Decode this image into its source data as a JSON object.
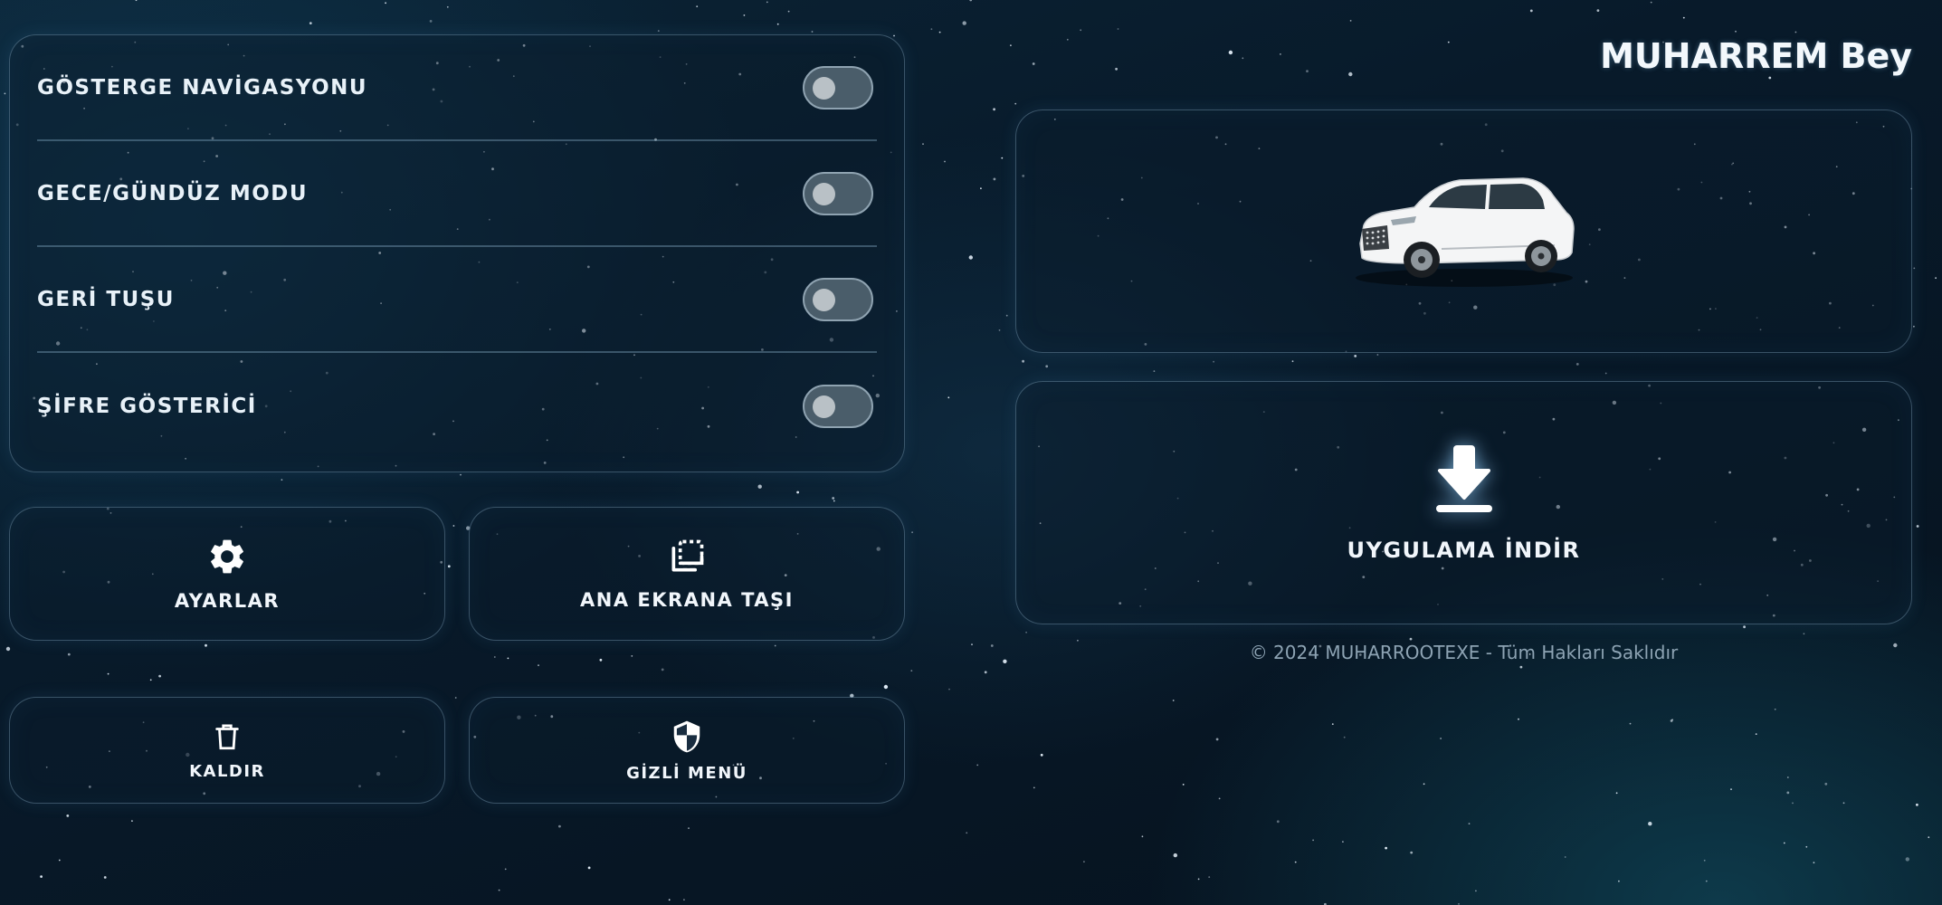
{
  "header": {
    "user_name": "MUHARREM Bey"
  },
  "toggles": [
    {
      "label": "GÖSTERGE NAVİGASYONU",
      "on": false
    },
    {
      "label": "GECE/GÜNDÜZ MODU",
      "on": false
    },
    {
      "label": "GERİ TUŞU",
      "on": false
    },
    {
      "label": "ŞİFRE GÖSTERİCİ",
      "on": false
    }
  ],
  "actions": {
    "settings": {
      "label": "AYARLAR",
      "icon": "gear-icon"
    },
    "move_home": {
      "label": "ANA EKRANA TAŞI",
      "icon": "move-to-home-icon"
    },
    "remove": {
      "label": "KALDIR",
      "icon": "trash-icon"
    },
    "hidden_menu": {
      "label": "GİZLİ MENÜ",
      "icon": "shield-icon"
    }
  },
  "download": {
    "label": "UYGULAMA İNDİR",
    "icon": "download-icon"
  },
  "vehicle": {
    "icon": "car-image"
  },
  "footer": {
    "text": "© 2024 MUHARROOTEXE - Tüm Hakları Saklıdır"
  },
  "colors": {
    "background": "#081a2a",
    "panel_border": "#96bed7",
    "text": "#e8f1f8",
    "toggle_off": "#4a5d6a"
  }
}
